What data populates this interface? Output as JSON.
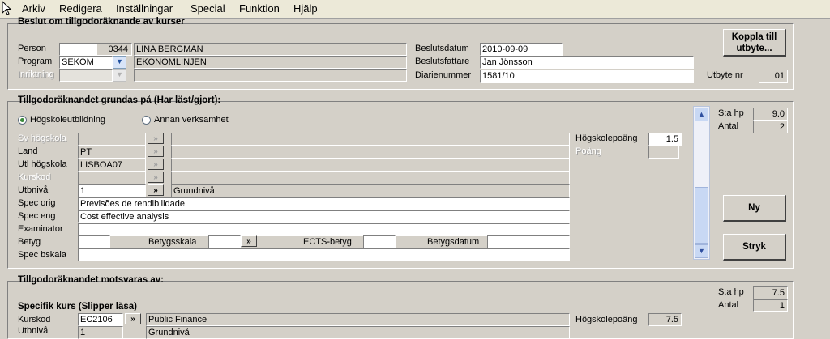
{
  "menu": [
    "Arkiv",
    "Redigera",
    "Inställningar",
    "Special",
    "Funktion",
    "Hjälp"
  ],
  "beslut": {
    "title": "Beslut om tillgodoräknande av kurser",
    "person_label": "Person",
    "person_id": "0344",
    "person_name": "LINA BERGMAN",
    "program_label": "Program",
    "program_value": "SEKOM",
    "program_name": "EKONOMLINJEN",
    "inriktning_label": "Inriktning",
    "beslutsdatum_label": "Beslutsdatum",
    "beslutsdatum": "2010-09-09",
    "beslutsfattare_label": "Beslutsfattare",
    "beslutsfattare": "Jan Jönsson",
    "diarienummer_label": "Diarienummer",
    "diarienummer": "1581/10",
    "utbyte_label": "Utbyte nr",
    "utbyte_nr": "01",
    "koppla_line1": "Koppla till",
    "koppla_line2": "utbyte..."
  },
  "grundas": {
    "title": "Tillgodoräknandet grundas på (Har läst/gjort):",
    "radio_hogskola": "Högskoleutbildning",
    "radio_annan": "Annan verksamhet",
    "sv_hogskola_label": "Sv högskola",
    "land_label": "Land",
    "land_value": "PT",
    "utl_hogskola_label": "Utl högskola",
    "utl_hogskola_value": "LISBOA07",
    "kurskod_label": "Kurskod",
    "utbniva_label": "Utbnivå",
    "utbniva_value": "1",
    "utbniva_text": "Grundnivå",
    "spec_orig_label": "Spec orig",
    "spec_orig": "Previsões de rendibilidade",
    "spec_eng_label": "Spec eng",
    "spec_eng": "Cost effective analysis",
    "examinator_label": "Examinator",
    "betyg_label": "Betyg",
    "betygsskala_label": "Betygsskala",
    "ects_label": "ECTS-betyg",
    "betygsdatum_label": "Betygsdatum",
    "spec_bskala_label": "Spec bskala",
    "hogskolepoang_label": "Högskolepoäng",
    "hogskolepoang": "1.5",
    "poang_label": "Poäng",
    "sa_hp_label": "S:a hp",
    "sa_hp": "9.0",
    "antal_label": "Antal",
    "antal": "2",
    "ny_button": "Ny",
    "stryk_button": "Stryk"
  },
  "motsvaras": {
    "title": "Tillgodoräknandet motsvaras av:",
    "specifik_title": "Specifik kurs (Slipper läsa)",
    "sa_hp_label": "S:a hp",
    "sa_hp": "7.5",
    "antal_label": "Antal",
    "antal": "1",
    "kurskod_label": "Kurskod",
    "kurskod": "EC2106",
    "kurs_name": "Public Finance",
    "hogskolepoang_label": "Högskolepoäng",
    "hogskolepoang": "7.5",
    "utbniva_label": "Utbnivå",
    "utbniva_value": "1",
    "utbniva_text": "Grundnivå"
  },
  "icons": {
    "arrow_button": "»",
    "dropdown": "chevron-down-icon",
    "scroll_up": "chevron-up-icon",
    "scroll_down": "chevron-down-icon",
    "cursor": "mouse-pointer-icon"
  }
}
